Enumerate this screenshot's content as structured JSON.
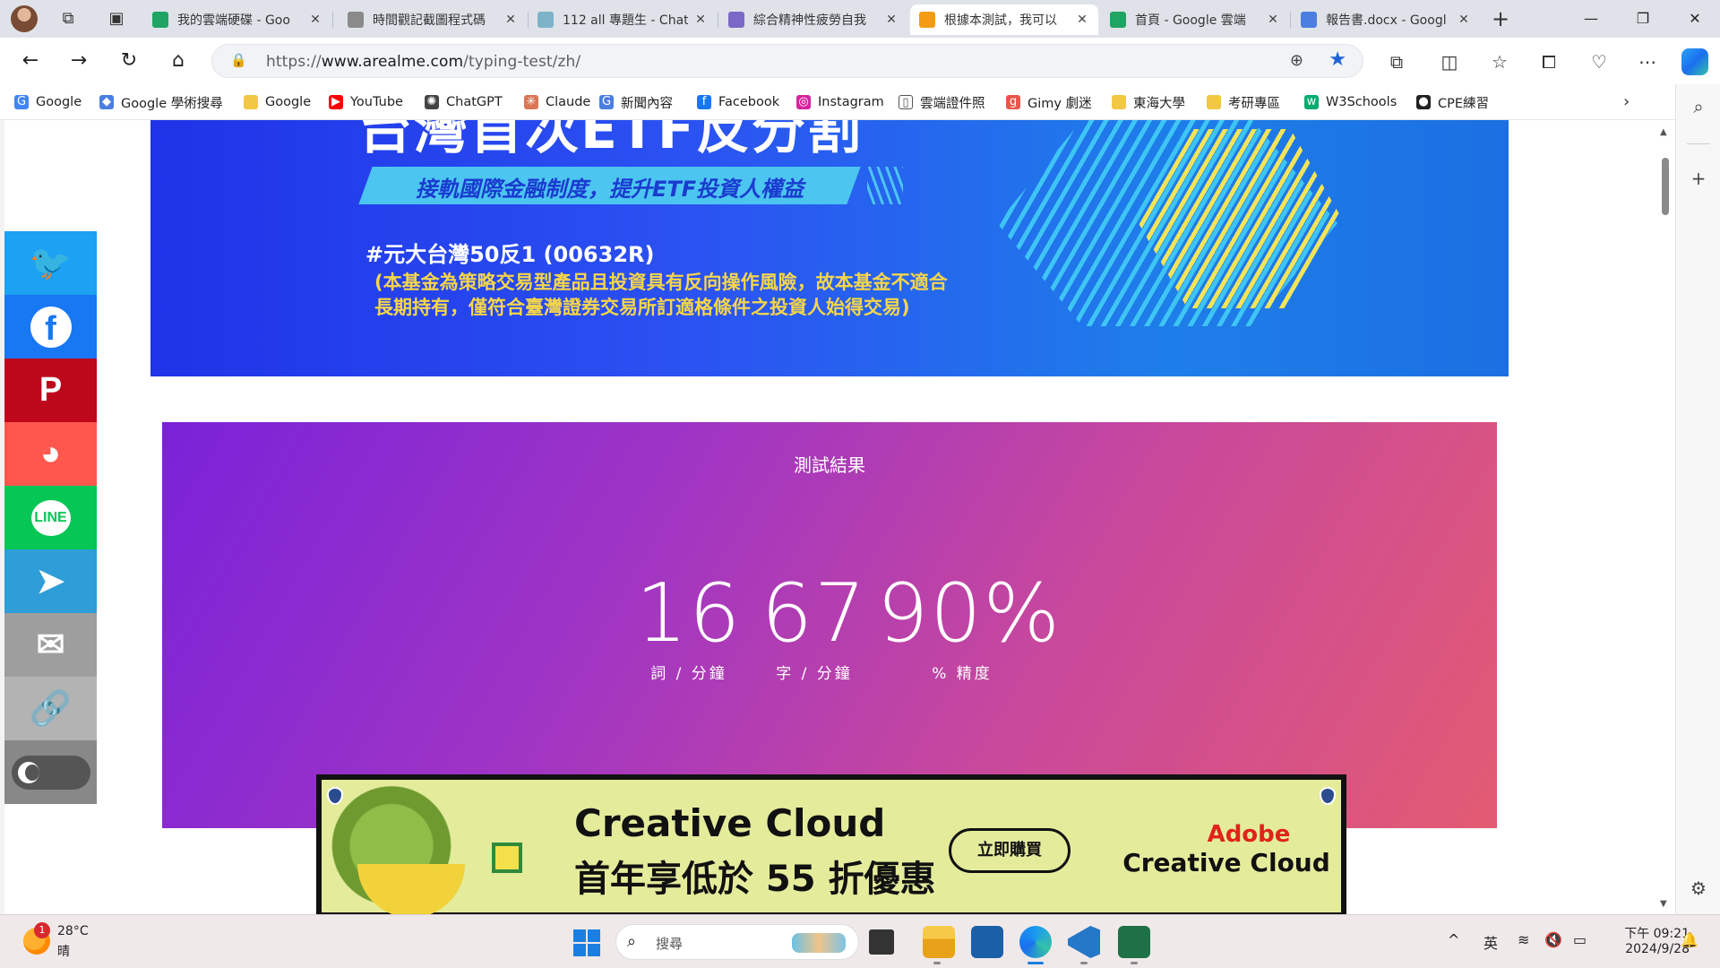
{
  "tabs": [
    {
      "title": "我的雲端硬碟 - Goo",
      "favicon_color": "#1fa463",
      "icon": "google-drive-icon"
    },
    {
      "title": "時間觀記截圖程式碼",
      "favicon_color": "#8a8a8a",
      "icon": "chatgpt-icon"
    },
    {
      "title": "112 all 專題生 - Chat",
      "favicon_color": "#7db3c9",
      "icon": "chat-icon"
    },
    {
      "title": "綜合精神性疲勞自我",
      "favicon_color": "#7b68c9",
      "icon": "forms-icon"
    },
    {
      "title": "根據本測試，我可以",
      "favicon_color": "#f39c12",
      "icon": "arealme-icon"
    },
    {
      "title": "首頁 - Google 雲端",
      "favicon_color": "#1fa463",
      "icon": "google-drive-icon"
    },
    {
      "title": "報告書.docx - Googl",
      "favicon_color": "#4a7fe0",
      "icon": "docs-icon"
    }
  ],
  "active_tab_index": 4,
  "address": {
    "prefix": "https://",
    "domain": "www.arealme.com",
    "path": "/typing-test/zh/"
  },
  "bookmarks": [
    {
      "label": "Google",
      "icon": "google-icon",
      "color": "#4285f4",
      "glyph": "G"
    },
    {
      "label": "Google 學術搜尋",
      "icon": "scholar-icon",
      "color": "#4a7fe0",
      "glyph": "◆"
    },
    {
      "label": "Google",
      "icon": "folder-icon",
      "color": "#f2c744",
      "glyph": ""
    },
    {
      "label": "YouTube",
      "icon": "youtube-icon",
      "color": "#ff0000",
      "glyph": "▶"
    },
    {
      "label": "ChatGPT",
      "icon": "chatgpt-icon",
      "color": "#444444",
      "glyph": "✺"
    },
    {
      "label": "Claude",
      "icon": "claude-icon",
      "color": "#d97757",
      "glyph": "✳"
    },
    {
      "label": "新聞內容",
      "icon": "news-icon",
      "color": "#4a7fe0",
      "glyph": "G"
    },
    {
      "label": "Facebook",
      "icon": "facebook-icon",
      "color": "#1877f2",
      "glyph": "f"
    },
    {
      "label": "Instagram",
      "icon": "instagram-icon",
      "color": "#d6249f",
      "glyph": "◎"
    },
    {
      "label": "雲端證件照",
      "icon": "page-icon",
      "color": "#ffffff",
      "glyph": "▯"
    },
    {
      "label": "Gimy 劇迷",
      "icon": "gimy-icon",
      "color": "#e8564b",
      "glyph": "g"
    },
    {
      "label": "東海大學",
      "icon": "folder-icon",
      "color": "#f2c744",
      "glyph": ""
    },
    {
      "label": "考研專區",
      "icon": "folder-icon",
      "color": "#f2c744",
      "glyph": ""
    },
    {
      "label": "W3Schools",
      "icon": "w3schools-icon",
      "color": "#04aa6d",
      "glyph": "w"
    },
    {
      "label": "CPE練習",
      "icon": "github-icon",
      "color": "#222222",
      "glyph": "●"
    }
  ],
  "banner": {
    "title": "台灣首次ETF反分割",
    "subtitle": "接軌國際金融制度，提升ETF投資人權益",
    "fund": "#元大台灣50反1 (00632R)",
    "warning": "(本基金為策略交易型產品且投資具有反向操作風險，故本基金不適合\n長期持有，僅符合臺灣證券交易所訂適格條件之投資人始得交易)"
  },
  "share": [
    {
      "name": "twitter",
      "color": "#1da1f2",
      "glyph": "🐦"
    },
    {
      "name": "facebook",
      "color": "#1877f2",
      "glyph": "f"
    },
    {
      "name": "pinterest",
      "color": "#bd081c",
      "glyph": "P"
    },
    {
      "name": "plurk",
      "color": "#ff574d",
      "glyph": "◕"
    },
    {
      "name": "line",
      "color": "#06c755",
      "glyph": "LINE"
    },
    {
      "name": "telegram",
      "color": "#2f9ed8",
      "glyph": "➤"
    },
    {
      "name": "email",
      "color": "#9e9e9e",
      "glyph": "✉"
    },
    {
      "name": "copy-link",
      "color": "#b3b3b3",
      "glyph": "🔗"
    }
  ],
  "result": {
    "title": "測試結果",
    "stats": [
      {
        "value": "16",
        "label": "詞 / 分鐘"
      },
      {
        "value": "67",
        "label": "字 / 分鐘"
      },
      {
        "value": "90%",
        "label": "% 精度"
      }
    ]
  },
  "ad": {
    "line1": "Creative Cloud",
    "line2": "首年享低於 55 折優惠",
    "button": "立即購買",
    "brand1": "Adobe",
    "brand2": "Creative Cloud"
  },
  "taskbar": {
    "weather_temp": "28°C",
    "weather_cond": "晴",
    "weather_badge": "1",
    "search_placeholder": "搜尋",
    "ime": "英",
    "time": "下午 09:21",
    "date": "2024/9/28"
  }
}
